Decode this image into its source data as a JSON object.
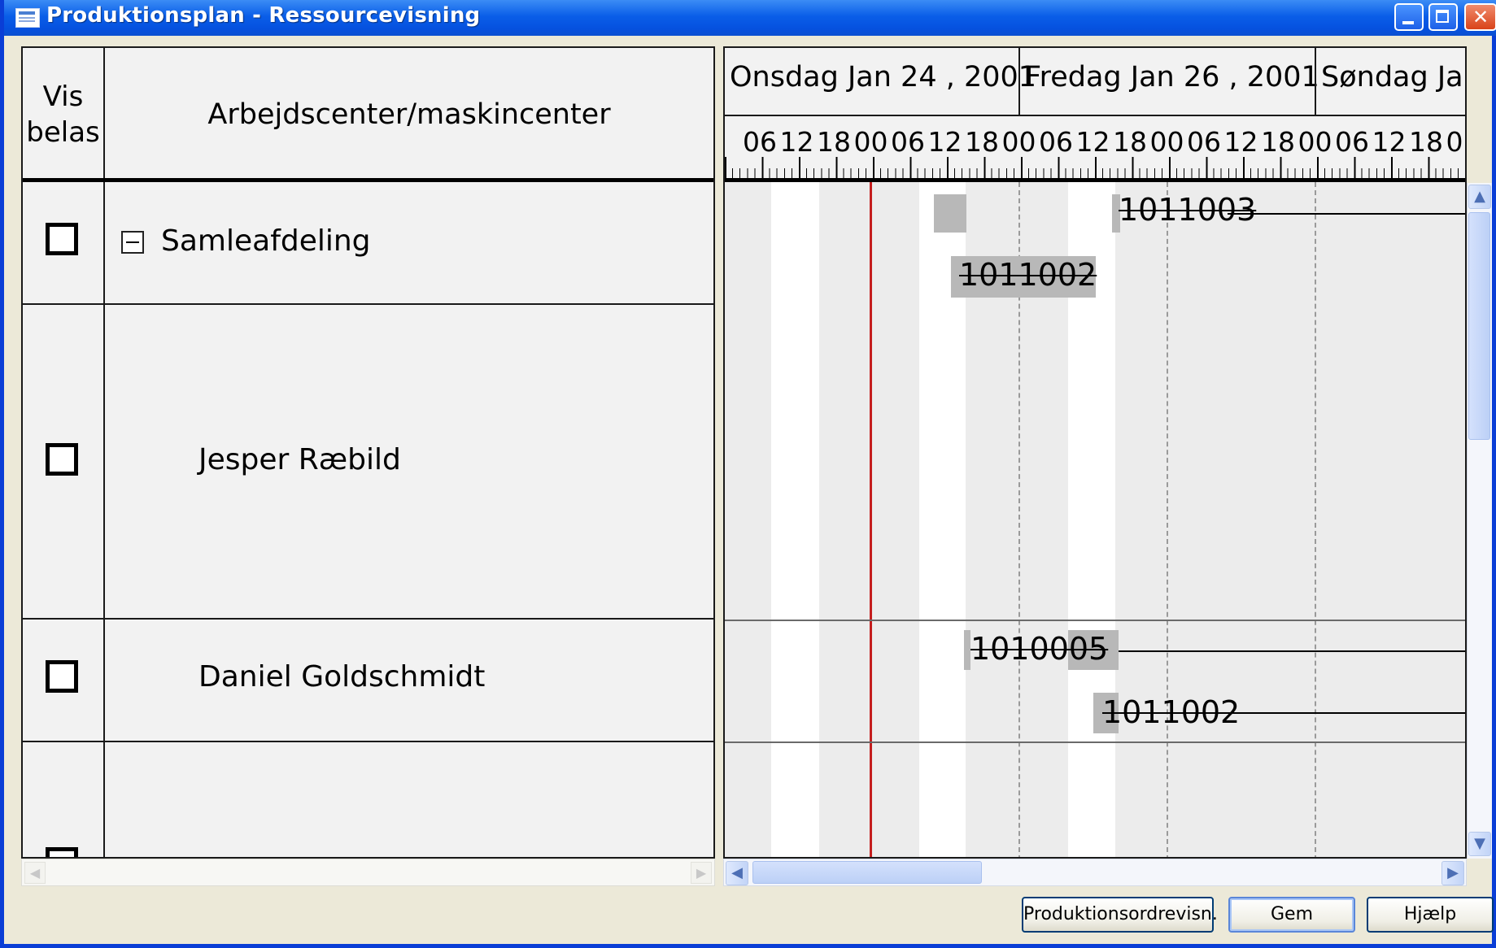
{
  "window": {
    "title": "Produktionsplan - Ressourcevisning"
  },
  "left_grid": {
    "header_vis": "Vis\nbelas",
    "header_name": "Arbejdscenter/maskincenter",
    "rows": [
      {
        "name": "Samleafdeling",
        "expander": "−"
      },
      {
        "name": "Jesper Ræbild"
      },
      {
        "name": "Daniel Goldschmidt"
      },
      {
        "name": ""
      }
    ]
  },
  "gantt": {
    "dates": [
      "Onsdag Jan 24 , 2001",
      "Fredag Jan 26 , 2001",
      "Søndag Jan"
    ],
    "hours": [
      "06",
      "12",
      "18",
      "00",
      "06",
      "12",
      "18",
      "00",
      "06",
      "12",
      "18",
      "00",
      "06",
      "12",
      "18",
      "00",
      "06",
      "12",
      "18",
      "0"
    ],
    "tasks": [
      {
        "label": "1011003"
      },
      {
        "label": "1011002"
      },
      {
        "label": "1010005"
      },
      {
        "label": "1011002"
      }
    ]
  },
  "buttons": {
    "order_view": "Produktionsordrevisn.",
    "save": "Gem",
    "help": "Hjælp"
  },
  "icons": {
    "window_icon": "form-icon",
    "scroll_up": "▲",
    "scroll_down": "▼",
    "scroll_left": "◀",
    "scroll_right": "▶"
  },
  "colors": {
    "titlebar": "#0a5ee8",
    "today_line": "#c41e1e",
    "task_bar": "#b8b8b8"
  }
}
